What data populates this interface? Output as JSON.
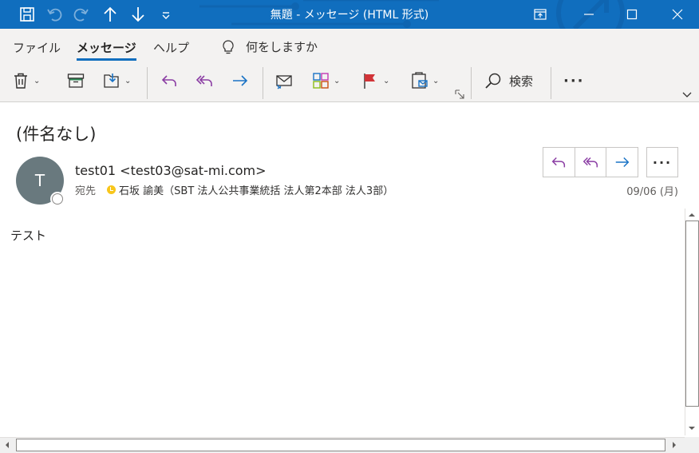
{
  "titlebar": {
    "title": "無題  -  メッセージ (HTML 形式)",
    "quick_access": [
      "save-icon",
      "undo-icon",
      "redo-icon",
      "up-arrow-icon",
      "down-arrow-icon",
      "customize-icon"
    ],
    "window_buttons": [
      "ribbon-display-icon",
      "minimize-icon",
      "maximize-icon",
      "close-icon"
    ],
    "color": "#106ebe"
  },
  "ribbon": {
    "tabs": [
      {
        "label": "ファイル"
      },
      {
        "label": "メッセージ"
      },
      {
        "label": "ヘルプ"
      }
    ],
    "active_tab": "メッセージ",
    "tell_me": "何をしますか",
    "search_label": "検索",
    "more_label": "···"
  },
  "message": {
    "subject": "(件名なし)",
    "avatar_initial": "T",
    "sender": "test01 <test03@sat-mi.com>",
    "to_label": "宛先",
    "recipient": "石坂  諭美（SBT  法人公共事業統括  法人第2本部  法人3部）",
    "date": "09/06 (月)",
    "more_label": "···",
    "body": "テスト"
  },
  "colors": {
    "accent": "#106ebe",
    "reply_purple": "#8b3ea4",
    "forward_blue": "#1a73c5",
    "flag_red": "#d13438",
    "presence_away": "#f8c61b"
  }
}
